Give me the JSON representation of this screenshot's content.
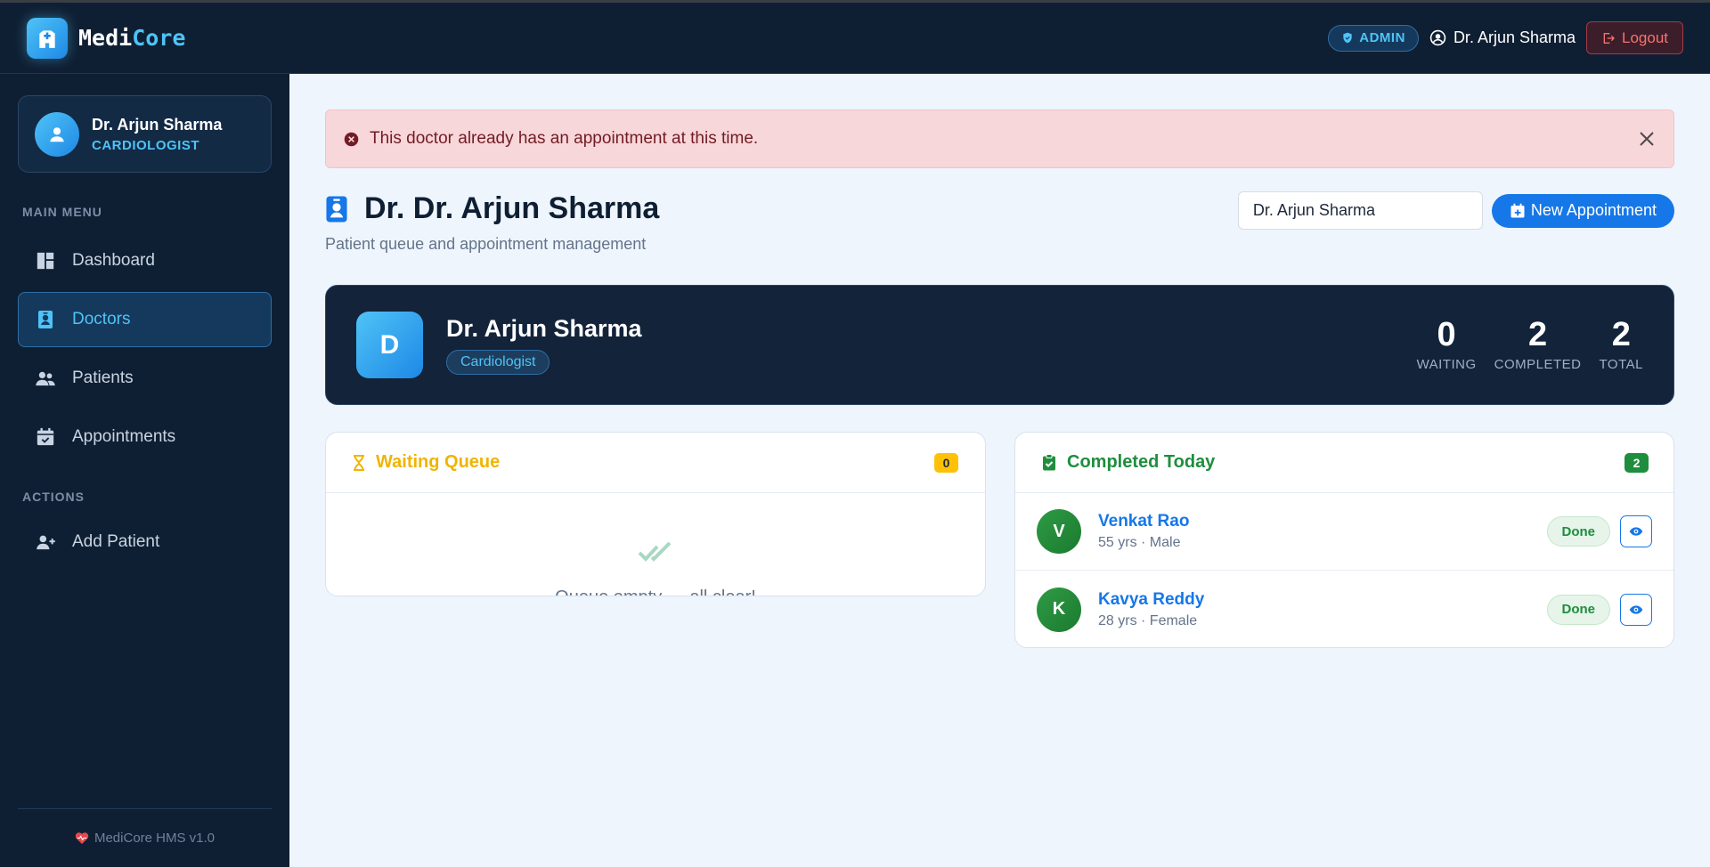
{
  "brand": {
    "name_part1": "Medi",
    "name_part2": "Core"
  },
  "topbar": {
    "role_badge": "ADMIN",
    "user_name": "Dr. Arjun Sharma",
    "logout_label": "Logout"
  },
  "sidebar": {
    "profile": {
      "name": "Dr. Arjun Sharma",
      "role": "CARDIOLOGIST"
    },
    "main_menu_label": "MAIN MENU",
    "main_items": [
      {
        "label": "Dashboard",
        "icon": "dashboard-icon"
      },
      {
        "label": "Doctors",
        "icon": "doctor-badge-icon",
        "active": true
      },
      {
        "label": "Patients",
        "icon": "users-icon"
      },
      {
        "label": "Appointments",
        "icon": "calendar-icon"
      }
    ],
    "actions_label": "ACTIONS",
    "action_items": [
      {
        "label": "Add Patient",
        "icon": "user-plus-icon"
      }
    ],
    "footer": "MediCore HMS v1.0"
  },
  "alert": {
    "message": "This doctor already has an appointment at this time.",
    "type": "error"
  },
  "page": {
    "title": "Dr. Dr. Arjun Sharma",
    "subtitle": "Patient queue and appointment management",
    "doctor_select_value": "Dr. Arjun Sharma",
    "new_appointment_label": "New Appointment"
  },
  "doctor": {
    "initial": "D",
    "name": "Dr. Arjun Sharma",
    "specialty": "Cardiologist",
    "stats": [
      {
        "value": "0",
        "label": "WAITING"
      },
      {
        "value": "2",
        "label": "COMPLETED"
      },
      {
        "value": "2",
        "label": "TOTAL"
      }
    ]
  },
  "waiting_queue": {
    "title": "Waiting Queue",
    "count": "0",
    "empty_text": "Queue empty — all clear!"
  },
  "completed_today": {
    "title": "Completed Today",
    "count": "2",
    "patients": [
      {
        "initial": "V",
        "name": "Venkat Rao",
        "meta": "55 yrs · Male",
        "status": "Done"
      },
      {
        "initial": "K",
        "name": "Kavya Reddy",
        "meta": "28 yrs · Female",
        "status": "Done"
      }
    ]
  },
  "colors": {
    "accent": "#4fc3f7",
    "primary": "#1677e8",
    "success": "#1e8e3e",
    "warning": "#f0b400",
    "danger_bg": "#f8d7da",
    "sidebar_bg": "#0f1f33"
  }
}
